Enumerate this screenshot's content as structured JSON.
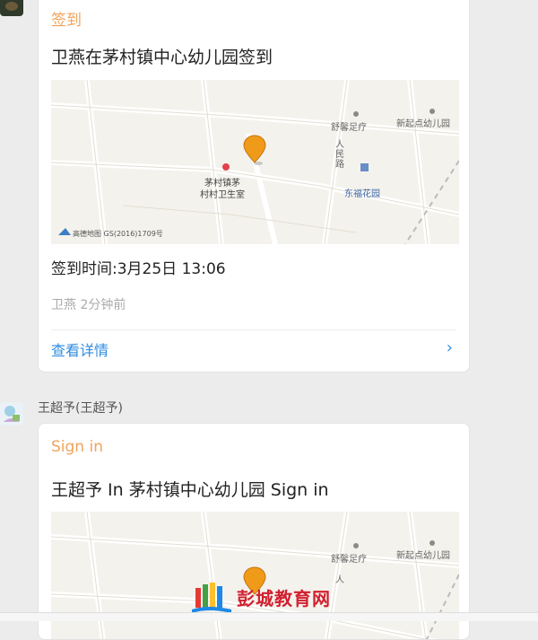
{
  "messages": [
    {
      "card": {
        "type_label": "签到",
        "title": "卫燕在茅村镇中心幼儿园签到",
        "map": {
          "labels": {
            "place1": "舒馨足疗",
            "place2": "新起点幼儿园",
            "road": "人民路",
            "poi1_line1": "茅村镇茅",
            "poi1_line2": "村村卫生室",
            "poi2": "东福花园",
            "copyright": "高德地图 GS(2016)1709号"
          }
        },
        "sign_time": "签到时间:3月25日 13:06",
        "meta": "卫燕 2分钟前",
        "detail_link": "查看详情",
        "chevron": "›"
      }
    },
    {
      "sender": "王超予(王超予)",
      "card": {
        "type_label": "Sign in",
        "title": "王超予 In 茅村镇中心幼儿园 Sign in",
        "map": {
          "labels": {
            "place1": "舒馨足疗",
            "place2": "新起点幼儿园",
            "road": "人"
          }
        }
      }
    }
  ],
  "watermark": {
    "text": "彭城教育网"
  },
  "colors": {
    "accent_orange": "#f0a35c",
    "link_blue": "#2f8de0",
    "pin": "#f09a1a"
  }
}
